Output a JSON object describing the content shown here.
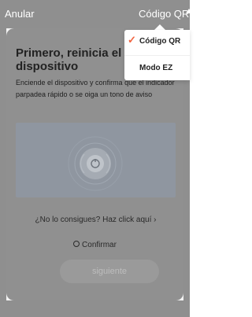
{
  "topbar": {
    "cancel_label": "Anular",
    "mode_label": "Código QR"
  },
  "card": {
    "title": "Primero, reinicia el dispositivo",
    "description": "Enciende el dispositivo y confirma que el indicador parpadea rápido o se oiga un tono de aviso",
    "help_link": "¿No lo consigues? Haz click aquí ›",
    "confirm_label": "Confirmar",
    "next_label": "siguiente"
  },
  "dropdown": {
    "items": [
      {
        "label": "Código QR",
        "selected": true
      },
      {
        "label": "Modo EZ",
        "selected": false
      }
    ]
  },
  "colors": {
    "accent": "#f26440"
  }
}
